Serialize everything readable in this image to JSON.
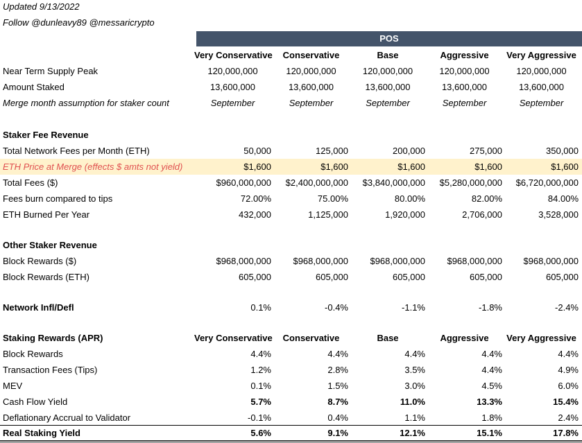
{
  "meta": {
    "updated": "Updated 9/13/2022",
    "follow": "Follow @dunleavy89 @messaricrypto"
  },
  "header": {
    "group": "POS",
    "scenarios": [
      "Very Conservative",
      "Conservative",
      "Base",
      "Aggressive",
      "Very Aggressive"
    ]
  },
  "assumptions": [
    {
      "label": "Near Term Supply Peak",
      "values": [
        "120,000,000",
        "120,000,000",
        "120,000,000",
        "120,000,000",
        "120,000,000"
      ]
    },
    {
      "label": "Amount Staked",
      "values": [
        "13,600,000",
        "13,600,000",
        "13,600,000",
        "13,600,000",
        "13,600,000"
      ]
    },
    {
      "label": "Merge month assumption for staker count",
      "values": [
        "September",
        "September",
        "September",
        "September",
        "September"
      ]
    }
  ],
  "fee_section": {
    "title": "Staker Fee Revenue",
    "rows": [
      {
        "label": "Total Network Fees per Month (ETH)",
        "values": [
          "50,000",
          "125,000",
          "200,000",
          "275,000",
          "350,000"
        ]
      },
      {
        "label": "ETH Price at Merge (effects $ amts not yield)",
        "values": [
          "$1,600",
          "$1,600",
          "$1,600",
          "$1,600",
          "$1,600"
        ]
      },
      {
        "label": "Total Fees ($)",
        "values": [
          "$960,000,000",
          "$2,400,000,000",
          "$3,840,000,000",
          "$5,280,000,000",
          "$6,720,000,000"
        ]
      },
      {
        "label": "Fees burn compared to tips",
        "values": [
          "72.00%",
          "75.00%",
          "80.00%",
          "82.00%",
          "84.00%"
        ]
      },
      {
        "label": "ETH Burned Per Year",
        "values": [
          "432,000",
          "1,125,000",
          "1,920,000",
          "2,706,000",
          "3,528,000"
        ]
      }
    ]
  },
  "other_section": {
    "title": "Other Staker Revenue",
    "rows": [
      {
        "label": "Block Rewards ($)",
        "values": [
          "$968,000,000",
          "$968,000,000",
          "$968,000,000",
          "$968,000,000",
          "$968,000,000"
        ]
      },
      {
        "label": "Block Rewards (ETH)",
        "values": [
          "605,000",
          "605,000",
          "605,000",
          "605,000",
          "605,000"
        ]
      }
    ]
  },
  "network": {
    "label": "Network Infl/Defl",
    "values": [
      "0.1%",
      "-0.4%",
      "-1.1%",
      "-1.8%",
      "-2.4%"
    ]
  },
  "staking_section": {
    "title": "Staking Rewards (APR)",
    "rows": [
      {
        "label": "Block Rewards",
        "values": [
          "4.4%",
          "4.4%",
          "4.4%",
          "4.4%",
          "4.4%"
        ]
      },
      {
        "label": "Transaction Fees (Tips)",
        "values": [
          "1.2%",
          "2.8%",
          "3.5%",
          "4.4%",
          "4.9%"
        ]
      },
      {
        "label": "MEV",
        "values": [
          "0.1%",
          "1.5%",
          "3.0%",
          "4.5%",
          "6.0%"
        ]
      },
      {
        "label": "Cash Flow Yield",
        "values": [
          "5.7%",
          "8.7%",
          "11.0%",
          "13.3%",
          "15.4%"
        ]
      },
      {
        "label": "Deflationary Accrual to Validator",
        "values": [
          "-0.1%",
          "0.4%",
          "1.1%",
          "1.8%",
          "2.4%"
        ]
      },
      {
        "label": "Real Staking Yield",
        "values": [
          "5.6%",
          "9.1%",
          "12.1%",
          "15.1%",
          "17.8%"
        ]
      }
    ]
  },
  "colors": {
    "header_bg": "#44546a",
    "highlight_bg": "#fff2cc",
    "highlight_text": "#e05050"
  }
}
